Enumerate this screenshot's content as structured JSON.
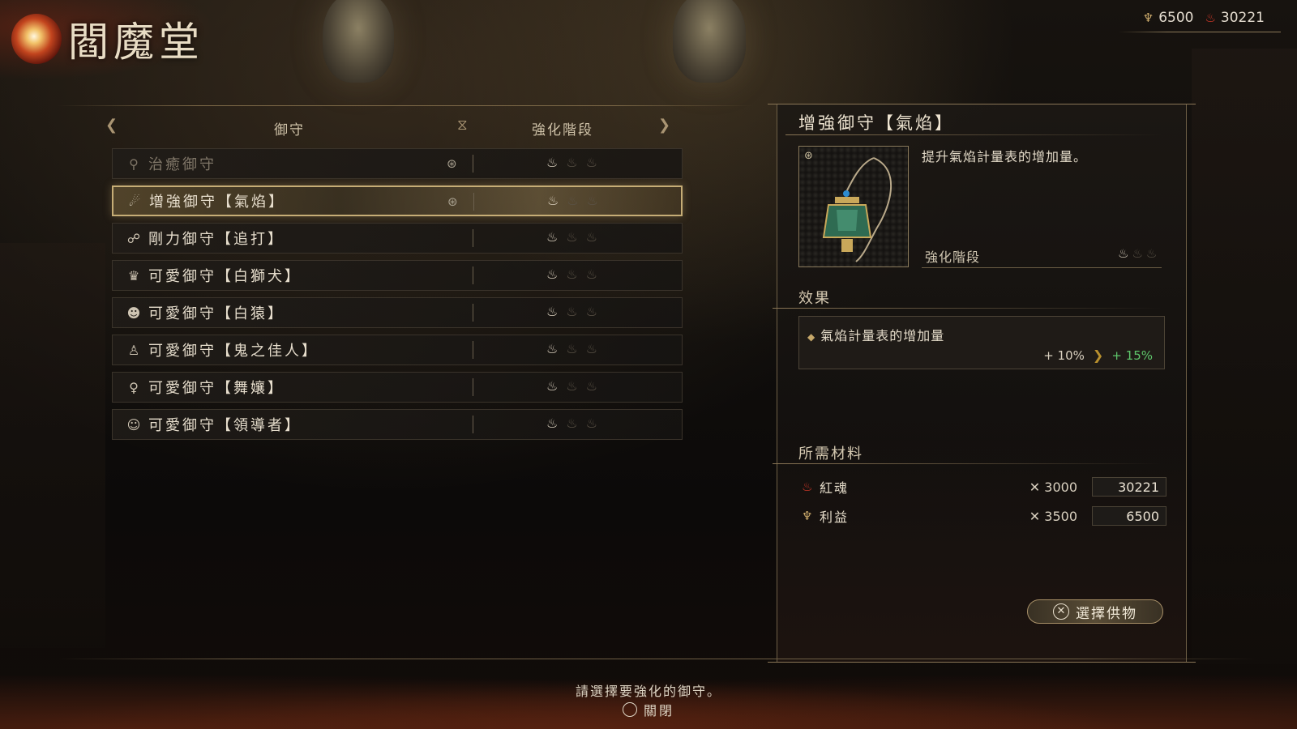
{
  "title": "閻魔堂",
  "currency": {
    "fortune": "6500",
    "amrita": "30221"
  },
  "list": {
    "header_name": "御守",
    "header_stage": "強化階段",
    "items": [
      {
        "name": "治癒御守",
        "stage": 1,
        "disabled": true,
        "equipped": true
      },
      {
        "name": "增強御守【氣焰】",
        "stage": 1,
        "selected": true,
        "equipped": true
      },
      {
        "name": "剛力御守【追打】",
        "stage": 1
      },
      {
        "name": "可愛御守【白獅犬】",
        "stage": 1
      },
      {
        "name": "可愛御守【白猿】",
        "stage": 1
      },
      {
        "name": "可愛御守【鬼之佳人】",
        "stage": 1
      },
      {
        "name": "可愛御守【舞孃】",
        "stage": 1
      },
      {
        "name": "可愛御守【領導者】",
        "stage": 1
      }
    ],
    "max_stage": 3
  },
  "detail": {
    "title": "增強御守【氣焰】",
    "description": "提升氣焰計量表的增加量。",
    "stage_label": "強化階段",
    "stage": 1,
    "effects_label": "效果",
    "effect": {
      "name": "氣焰計量表的增加量",
      "current": "+ 10%",
      "next": "+ 15%"
    },
    "materials_label": "所需材料",
    "materials": [
      {
        "icon": "amrita-icon",
        "name": "紅魂",
        "need": "✕ 3000",
        "have": "30221"
      },
      {
        "icon": "fortune-icon",
        "name": "利益",
        "need": "✕ 3500",
        "have": "6500"
      }
    ],
    "select_button": "選擇供物"
  },
  "prompt": "請選擇要強化的御守。",
  "close_label": "關閉",
  "colors": {
    "accent_gold": "#c6ad76",
    "upgrade_green": "#5ec66b",
    "amrita_red": "#d83a2a"
  }
}
